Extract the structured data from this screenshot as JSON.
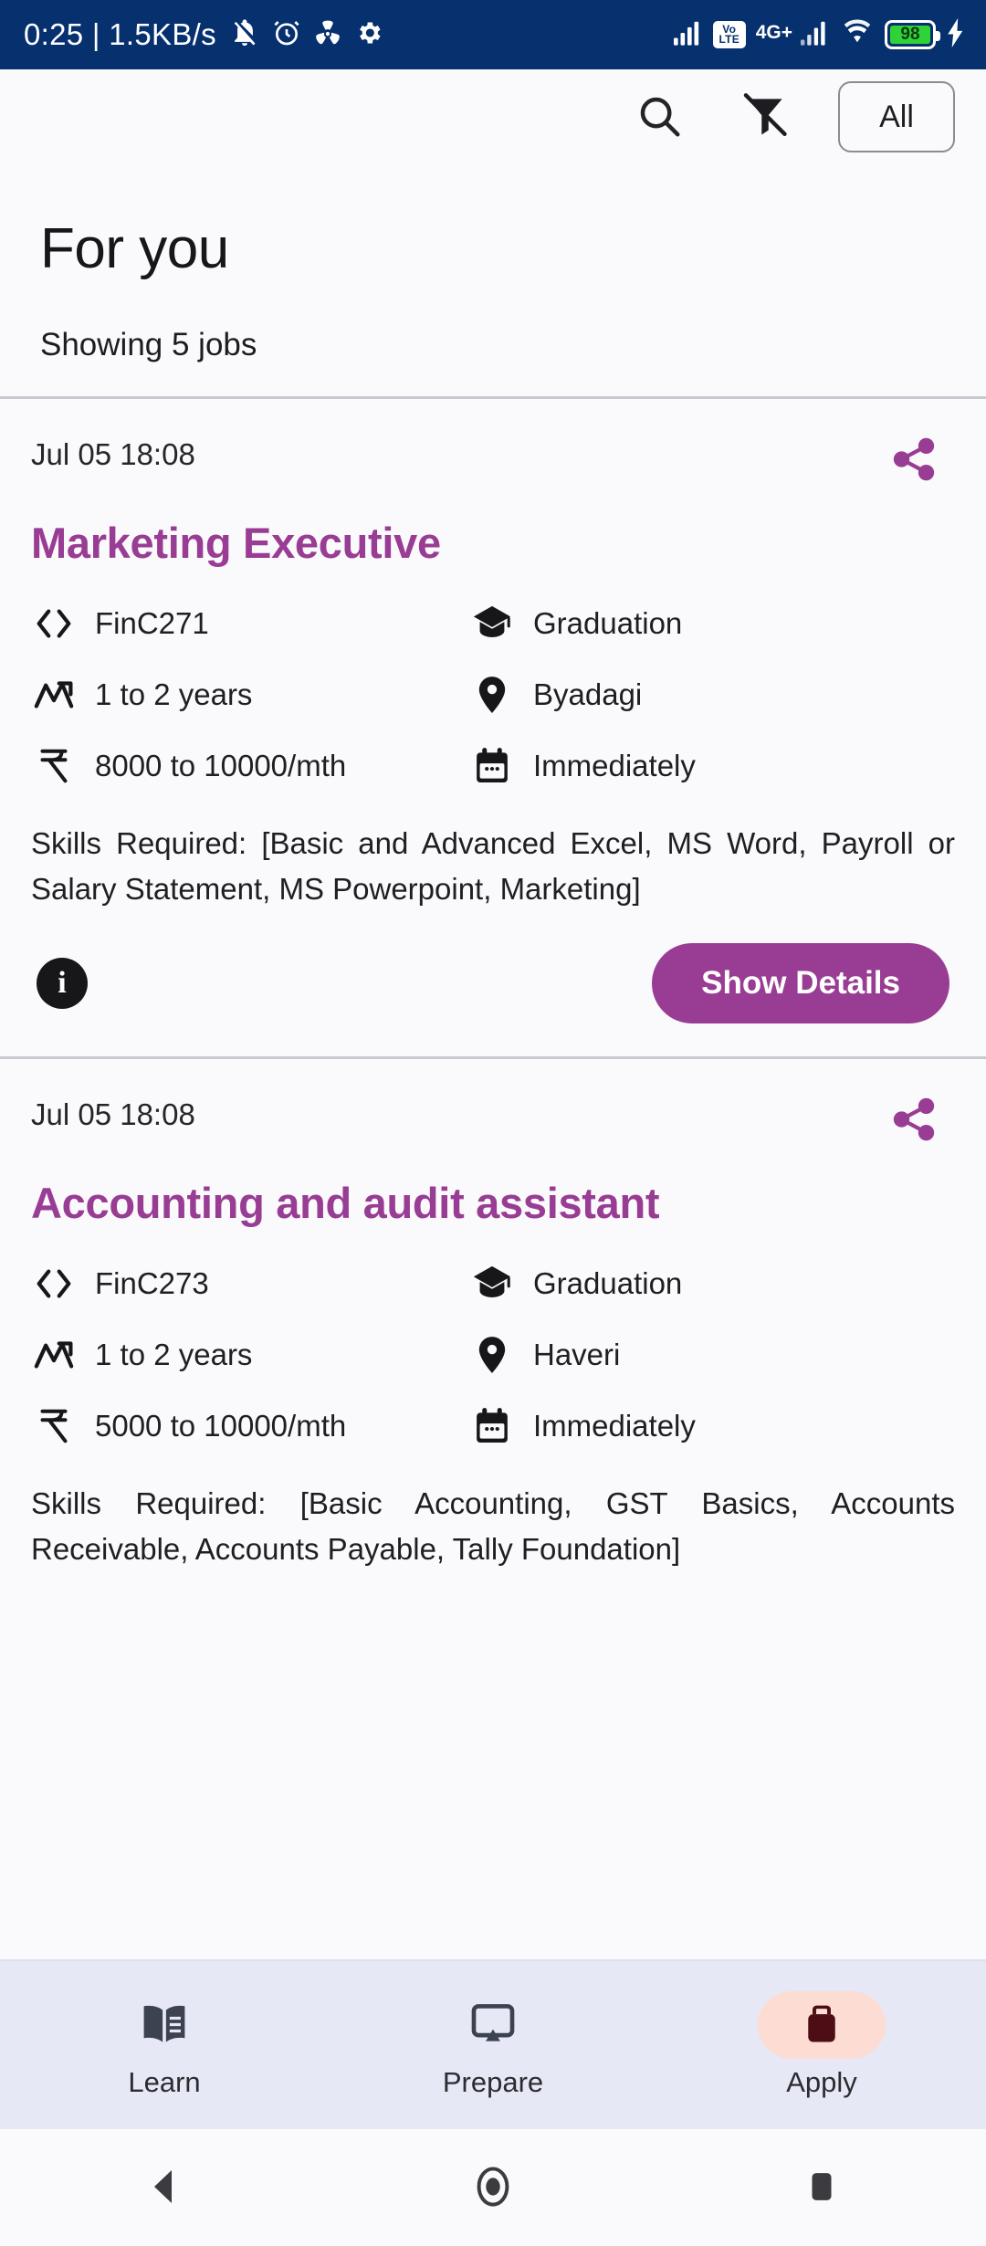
{
  "status_bar": {
    "clock_and_speed": "0:25 | 1.5KB/s",
    "left_icons": [
      "bell-muted-icon",
      "alarm-icon",
      "sync-icon",
      "gear-icon"
    ],
    "volte_top": "Vo",
    "volte_bottom": "LTE",
    "network_type": "4G+",
    "battery_percent": "98",
    "right_icons": [
      "signal-bars-icon",
      "volte-badge-icon",
      "signal-bars-2-icon",
      "wifi-icon",
      "battery-icon",
      "charging-bolt-icon"
    ],
    "background_color": "#06306e"
  },
  "toolbar": {
    "search_icon": "search-icon",
    "filter_off_icon": "filter-off-icon",
    "all_chip_label": "All"
  },
  "page": {
    "title": "For you",
    "subtitle": "Showing 5 jobs"
  },
  "theme": {
    "accent_purple": "#993d94",
    "nav_background": "#e7e8f5",
    "active_pill": "#fcdcd3",
    "page_background": "#fafafc"
  },
  "jobs": [
    {
      "date": "Jul 05 18:08",
      "title": "Marketing Executive",
      "code": "FinC271",
      "experience": "1 to 2 years",
      "salary": "8000 to 10000/mth",
      "education": "Graduation",
      "location": "Byadagi",
      "joining": "Immediately",
      "skills": "Skills Required: [Basic and Advanced Excel, MS Word, Payroll or Salary Statement, MS Powerpoint, Marketing]",
      "show_details_label": "Show Details",
      "info_label": "i"
    },
    {
      "date": "Jul 05 18:08",
      "title": "Accounting and audit assistant",
      "code": "FinC273",
      "experience": "1 to 2 years",
      "salary": "5000 to 10000/mth",
      "education": "Graduation",
      "location": "Haveri",
      "joining": "Immediately",
      "skills": "Skills Required: [Basic Accounting, GST Basics, Accounts Receivable, Accounts Payable, Tally Foundation]"
    }
  ],
  "bottom_nav": {
    "items": [
      {
        "label": "Learn",
        "icon": "book-icon",
        "active": false
      },
      {
        "label": "Prepare",
        "icon": "cast-screen-icon",
        "active": false
      },
      {
        "label": "Apply",
        "icon": "briefcase-icon",
        "active": true
      }
    ]
  },
  "system_nav": {
    "back": "back-triangle-icon",
    "home": "home-circle-icon",
    "recents": "recents-square-icon"
  }
}
